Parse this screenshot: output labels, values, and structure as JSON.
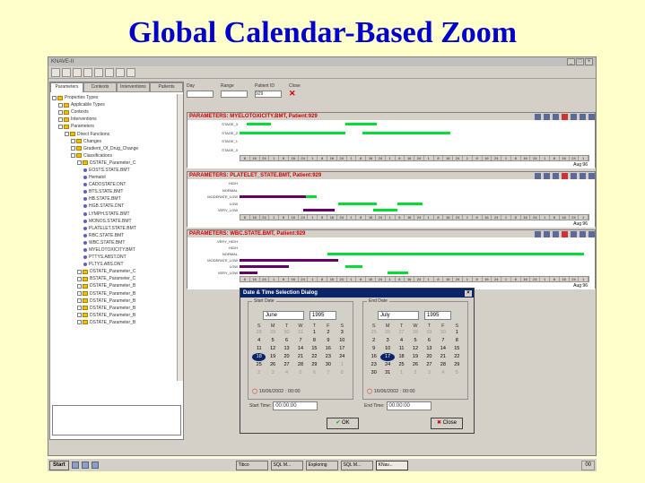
{
  "slide_title": "Global Calendar-Based Zoom",
  "window": {
    "title": "KNAVE-II"
  },
  "left_tabs": [
    "Parameters",
    "Contexts",
    "Interventions",
    "Patients"
  ],
  "tree_items": [
    {
      "level": 0,
      "kind": "folder",
      "label": "Properties Types"
    },
    {
      "level": 1,
      "kind": "folder",
      "label": "Applicable Types"
    },
    {
      "level": 1,
      "kind": "folder",
      "label": "Contexts"
    },
    {
      "level": 1,
      "kind": "folder",
      "label": "Interventions"
    },
    {
      "level": 1,
      "kind": "folder",
      "label": "Parameters"
    },
    {
      "level": 2,
      "kind": "folder",
      "label": "Direct Functions"
    },
    {
      "level": 3,
      "kind": "folder",
      "label": "Changes"
    },
    {
      "level": 3,
      "kind": "folder",
      "label": "Gradient_Of_Drug_Change"
    },
    {
      "level": 3,
      "kind": "folder",
      "label": "Classifications"
    },
    {
      "level": 4,
      "kind": "folder",
      "label": "DSTATE_Parameter_C"
    },
    {
      "level": 5,
      "kind": "dot",
      "label": "EOSTS.STATE.BMT"
    },
    {
      "level": 5,
      "kind": "dot",
      "label": "Hematol"
    },
    {
      "level": 5,
      "kind": "dot",
      "label": "CADOSTATE:DNT"
    },
    {
      "level": 5,
      "kind": "dot",
      "label": "BTS.STATE.BMT"
    },
    {
      "level": 5,
      "kind": "dot",
      "label": "HB.STATE.BMT"
    },
    {
      "level": 5,
      "kind": "dot",
      "label": "HGB.STATE.DNT"
    },
    {
      "level": 5,
      "kind": "dot",
      "label": "LYMPH.STATE.BMT"
    },
    {
      "level": 5,
      "kind": "dot",
      "label": "MONOS.STATE.BMT"
    },
    {
      "level": 5,
      "kind": "dot",
      "label": "PLATELET.STATE.BMT"
    },
    {
      "level": 5,
      "kind": "dot",
      "label": "RBC.STATE.BMT"
    },
    {
      "level": 5,
      "kind": "dot",
      "label": "WBC.STATE.BMT"
    },
    {
      "level": 5,
      "kind": "dot",
      "label": "MYELOTOXICITY.BMT"
    },
    {
      "level": 5,
      "kind": "dot",
      "label": "PTTYS.ABST.DNT"
    },
    {
      "level": 5,
      "kind": "dot",
      "label": "PLTYS.ABS.DNT"
    },
    {
      "level": 4,
      "kind": "folder",
      "label": "DSTATE_Parameter_C"
    },
    {
      "level": 4,
      "kind": "folder",
      "label": "BSTATE_Parameter_C"
    },
    {
      "level": 4,
      "kind": "folder",
      "label": "DSTATE_Parameter_B"
    },
    {
      "level": 4,
      "kind": "folder",
      "label": "DSTATE_Parameter_B"
    },
    {
      "level": 4,
      "kind": "folder",
      "label": "DSTATE_Parameter_B"
    },
    {
      "level": 4,
      "kind": "folder",
      "label": "DSTATE_Parameter_B"
    },
    {
      "level": 4,
      "kind": "folder",
      "label": "DSTATE_Parameter_B"
    },
    {
      "level": 4,
      "kind": "folder",
      "label": "DSTATE_Parameter_B"
    }
  ],
  "controls": {
    "day_label": "Day",
    "range_label": "Range",
    "patient_label": "Patient ID",
    "patient_value": "929",
    "close_label": "Close"
  },
  "panels": [
    {
      "title": "PARAMETERS: MYELOTOXICITY.BMT, Patient:929",
      "rows": [
        "STAGE_3",
        "STAGE_2",
        "STAGE_1",
        "STAGE_0"
      ],
      "ticks": [
        "8",
        "16",
        "24",
        "1",
        "8",
        "16",
        "24",
        "1",
        "8",
        "16",
        "24",
        "1",
        "8",
        "16",
        "24",
        "1",
        "8",
        "16",
        "24",
        "1",
        "8",
        "16",
        "24",
        "1",
        "8",
        "16",
        "24",
        "1",
        "8",
        "16",
        "24",
        "1",
        "8",
        "16",
        "24",
        "1"
      ],
      "bars": [
        {
          "row": 0,
          "color": "#00dd33",
          "from": 0.02,
          "to": 0.09
        },
        {
          "row": 0,
          "color": "#00dd33",
          "from": 0.3,
          "to": 0.39
        },
        {
          "row": 1,
          "color": "#00dd33",
          "from": 0.0,
          "to": 0.3
        },
        {
          "row": 1,
          "color": "#00dd33",
          "from": 0.35,
          "to": 0.6
        }
      ],
      "footer": "Aug 96"
    },
    {
      "title": "PARAMETERS: PLATELET_STATE.BMT, Patient:929",
      "rows": [
        "HIGH",
        "NORMAL",
        "MODERATE_LOW",
        "LOW",
        "VERY_LOW"
      ],
      "ticks": [
        "8",
        "16",
        "24",
        "1",
        "8",
        "16",
        "24",
        "1",
        "8",
        "16",
        "24",
        "1",
        "8",
        "16",
        "24",
        "1",
        "8",
        "16",
        "24",
        "1",
        "8",
        "16",
        "24",
        "1",
        "8",
        "16",
        "24",
        "1",
        "8",
        "16",
        "24",
        "1",
        "8",
        "16",
        "24",
        "1"
      ],
      "bars": [
        {
          "row": 2,
          "color": "#660066",
          "from": 0.0,
          "to": 0.19
        },
        {
          "row": 2,
          "color": "#00dd33",
          "from": 0.19,
          "to": 0.22
        },
        {
          "row": 3,
          "color": "#00dd33",
          "from": 0.28,
          "to": 0.39
        },
        {
          "row": 3,
          "color": "#00dd33",
          "from": 0.45,
          "to": 0.52
        },
        {
          "row": 4,
          "color": "#660066",
          "from": 0.18,
          "to": 0.27
        },
        {
          "row": 4,
          "color": "#00dd33",
          "from": 0.38,
          "to": 0.45
        }
      ],
      "footer": "Aug 96"
    },
    {
      "title": "PARAMETERS: WBC.STATE.BMT, Patient:929",
      "rows": [
        "VERY_HIGH",
        "HIGH",
        "NORMAL",
        "MODERATE_LOW",
        "LOW",
        "VERY_LOW"
      ],
      "ticks": [
        "8",
        "16",
        "24",
        "1",
        "8",
        "16",
        "24",
        "1",
        "8",
        "16",
        "24",
        "1",
        "8",
        "16",
        "24",
        "1",
        "8",
        "16",
        "24",
        "1",
        "8",
        "16",
        "24",
        "1",
        "8",
        "16",
        "24",
        "1",
        "8",
        "16",
        "24",
        "1",
        "8",
        "16",
        "24",
        "1"
      ],
      "bars": [
        {
          "row": 2,
          "color": "#00dd33",
          "from": 0.25,
          "to": 0.98
        },
        {
          "row": 3,
          "color": "#660066",
          "from": 0.0,
          "to": 0.28
        },
        {
          "row": 4,
          "color": "#660066",
          "from": 0.0,
          "to": 0.14
        },
        {
          "row": 4,
          "color": "#00dd33",
          "from": 0.3,
          "to": 0.35
        },
        {
          "row": 5,
          "color": "#660066",
          "from": 0.0,
          "to": 0.05
        },
        {
          "row": 5,
          "color": "#00dd33",
          "from": 0.42,
          "to": 0.48
        }
      ],
      "footer": "Aug 96"
    }
  ],
  "dialog": {
    "title": "Date & Time Selection Dialog",
    "start": {
      "label": "Start Date",
      "month": "June",
      "year": "1995",
      "weekdays": [
        "S",
        "M",
        "T",
        "W",
        "T",
        "F",
        "S"
      ],
      "days": [
        [
          "28",
          "29",
          "30",
          "31",
          "1",
          "2",
          "3"
        ],
        [
          "4",
          "5",
          "6",
          "7",
          "8",
          "9",
          "10"
        ],
        [
          "11",
          "12",
          "13",
          "14",
          "15",
          "16",
          "17"
        ],
        [
          "18",
          "19",
          "20",
          "21",
          "22",
          "23",
          "24"
        ],
        [
          "25",
          "26",
          "27",
          "28",
          "29",
          "30",
          "1"
        ],
        [
          "2",
          "3",
          "4",
          "5",
          "6",
          "7",
          "8"
        ]
      ],
      "selected": "18",
      "today": "16/06/2002 : 00:00",
      "time_label": "Start Time:",
      "time_value": "00:00:00"
    },
    "end": {
      "label": "End Date",
      "month": "July",
      "year": "1995",
      "weekdays": [
        "S",
        "M",
        "T",
        "W",
        "T",
        "F",
        "S"
      ],
      "days": [
        [
          "25",
          "26",
          "27",
          "28",
          "29",
          "30",
          "1"
        ],
        [
          "2",
          "3",
          "4",
          "5",
          "6",
          "7",
          "8"
        ],
        [
          "9",
          "10",
          "11",
          "12",
          "13",
          "14",
          "15"
        ],
        [
          "16",
          "17",
          "18",
          "19",
          "20",
          "21",
          "22"
        ],
        [
          "23",
          "24",
          "25",
          "26",
          "27",
          "28",
          "29"
        ],
        [
          "30",
          "31",
          "1",
          "2",
          "3",
          "4",
          "5"
        ]
      ],
      "selected": "17",
      "today": "16/06/2002 : 00:00",
      "time_label": "End Time:",
      "time_value": "00:00:00"
    },
    "ok_label": "OK",
    "cancel_label": "Close"
  },
  "taskbar": {
    "start_label": "Start",
    "tasks": [
      "Tibco",
      "SQL M...",
      "Exploring",
      "SQL M...",
      "KNav..."
    ],
    "clock": "00"
  }
}
